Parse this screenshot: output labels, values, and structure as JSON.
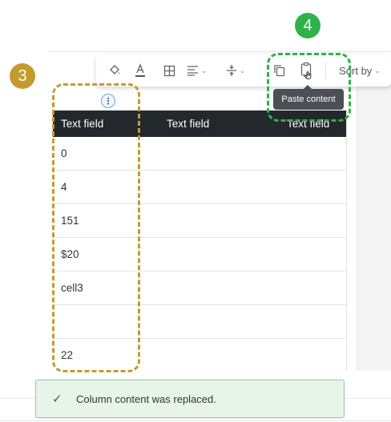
{
  "toolbar": {
    "sort_label": "Sort by",
    "buttons": [
      {
        "name": "fill-color-icon"
      },
      {
        "name": "text-color-icon"
      },
      {
        "name": "borders-icon"
      },
      {
        "name": "align-icon"
      },
      {
        "name": "vertical-align-icon"
      },
      {
        "name": "copy-content-icon"
      },
      {
        "name": "paste-content-icon"
      }
    ]
  },
  "tooltip": {
    "text": "Paste content"
  },
  "table": {
    "headers": [
      "Text field",
      "Text field",
      "Text field"
    ],
    "rows": [
      {
        "value": "0"
      },
      {
        "value": "4"
      },
      {
        "value": "151"
      },
      {
        "value": "$20"
      },
      {
        "value": "cell3"
      },
      {
        "value": ""
      },
      {
        "value": "22"
      }
    ],
    "column_menu_icon": "⋮"
  },
  "annotations": {
    "step3": "3",
    "step4": "4",
    "colors": {
      "step3": "#c49a2c",
      "step4": "#2fb24a"
    }
  },
  "toast": {
    "message": "Column content was replaced.",
    "icon": "✓"
  }
}
